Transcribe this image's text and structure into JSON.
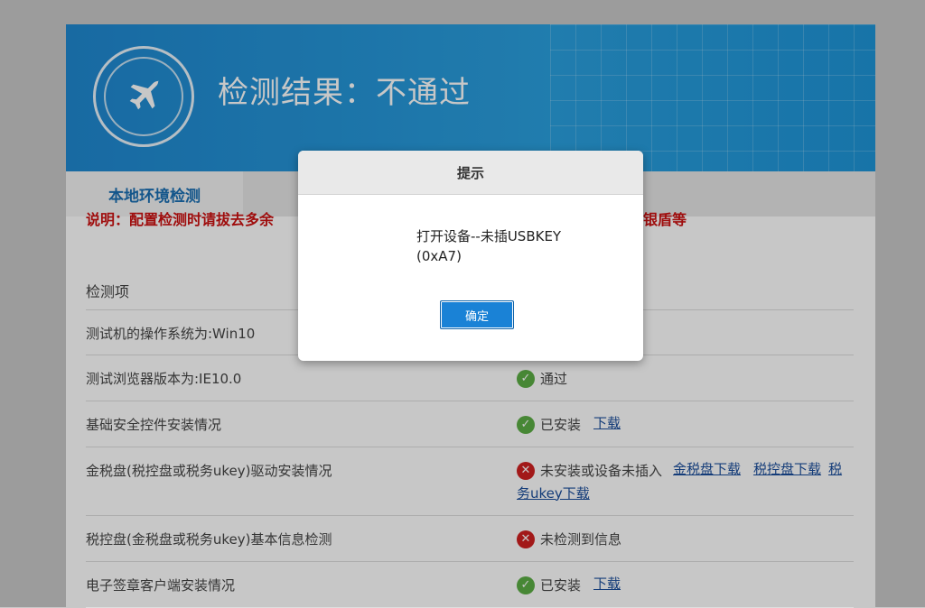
{
  "banner": {
    "title": "检测结果：不通过"
  },
  "tabs": {
    "active": "本地环境检测"
  },
  "notice": {
    "text": "说明：配置检测时请拔去多余",
    "tail": "银盾等"
  },
  "table": {
    "header": "检测项",
    "rows": [
      {
        "item": "测试机的操作系统为:Win10",
        "status": "",
        "links": []
      },
      {
        "item": "测试浏览器版本为:IE10.0",
        "status": "通过",
        "ok": true,
        "links": []
      },
      {
        "item": "基础安全控件安装情况",
        "status": "已安装",
        "ok": true,
        "links": [
          "下载"
        ]
      },
      {
        "item": "金税盘(税控盘或税务ukey)驱动安装情况",
        "status": "未安装或设备未插入",
        "ok": false,
        "links": [
          "金税盘下载",
          "税控盘下载",
          "税务ukey下载"
        ]
      },
      {
        "item": "税控盘(金税盘或税务ukey)基本信息检测",
        "status": "未检测到信息",
        "ok": false,
        "links": []
      },
      {
        "item": "电子签章客户端安装情况",
        "status": "已安装",
        "ok": true,
        "links": [
          "下载"
        ]
      }
    ]
  },
  "dialog": {
    "title": "提示",
    "message": "打开设备--未插USBKEY (0xA7)",
    "confirm_label": "确定"
  }
}
